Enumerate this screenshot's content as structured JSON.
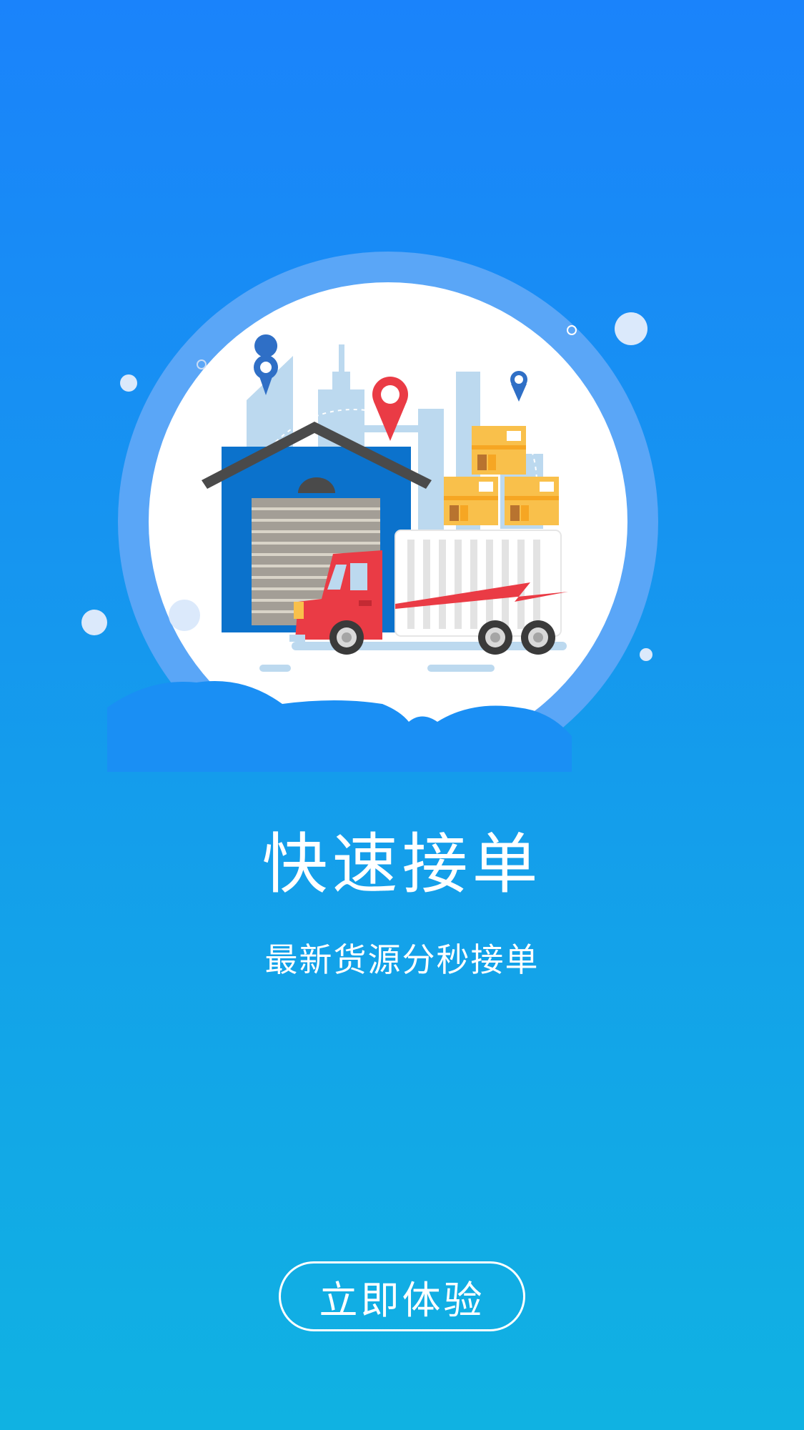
{
  "onboarding": {
    "title": "快速接单",
    "subtitle": "最新货源分秒接单",
    "cta_label": "立即体验"
  },
  "illustration": {
    "icons": [
      "warehouse-icon",
      "delivery-truck-icon",
      "location-pin-icon",
      "package-box-icon",
      "city-skyline-icon",
      "cloud-icon"
    ],
    "colors": {
      "background_top": "#1a83fb",
      "background_bottom": "#10b2e2",
      "ring": "#5aa6f7",
      "warehouse": "#0b72cc",
      "truck": "#ea3b45",
      "box": "#f9c04b",
      "pin_red": "#ea3b45",
      "pin_blue": "#2f6fc6"
    }
  }
}
